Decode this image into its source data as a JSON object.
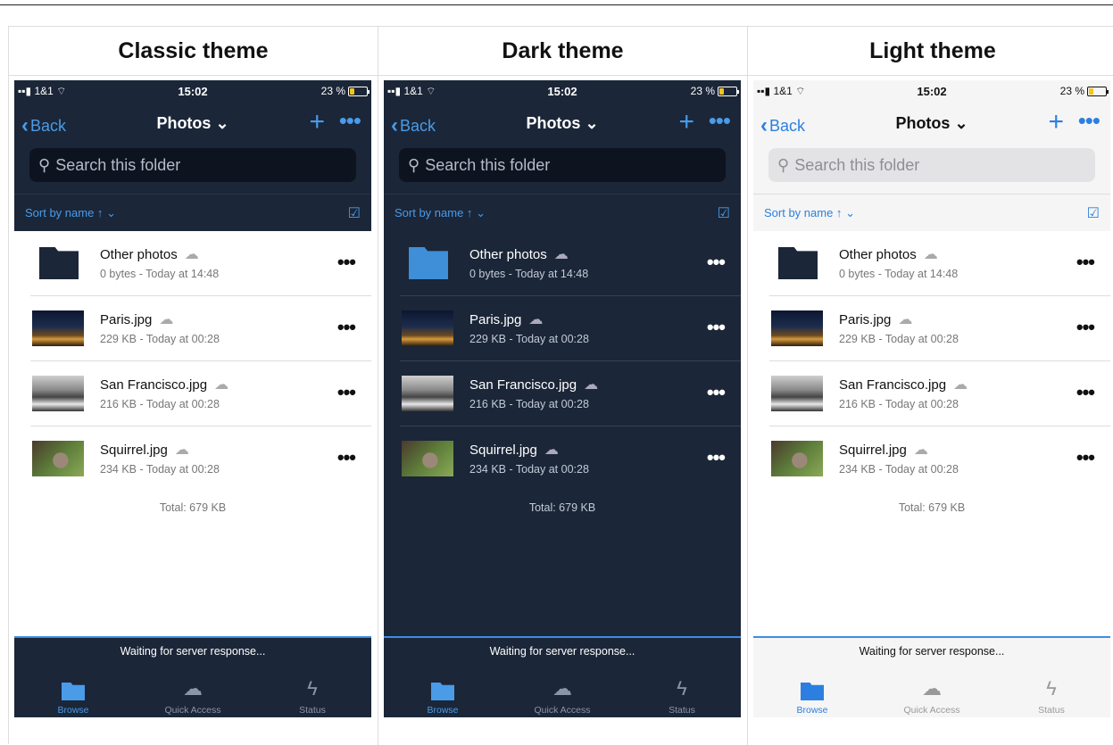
{
  "themes": [
    {
      "title": "Classic theme"
    },
    {
      "title": "Dark theme"
    },
    {
      "title": "Light theme"
    }
  ],
  "status": {
    "carrier": "1&1",
    "time": "15:02",
    "battery": "23 %"
  },
  "nav": {
    "back": "Back",
    "title": "Photos",
    "plus": "+",
    "more": "•••",
    "title_chevron": "⌄"
  },
  "search": {
    "placeholder": "Search this folder"
  },
  "sort": {
    "label": "Sort by name ↑",
    "chevron": "⌄"
  },
  "files": [
    {
      "name": "Other photos",
      "meta": "0 bytes - Today at 14:48",
      "kind": "folder"
    },
    {
      "name": "Paris.jpg",
      "meta": "229 KB - Today at 00:28",
      "kind": "paris"
    },
    {
      "name": "San Francisco.jpg",
      "meta": "216 KB - Today at 00:28",
      "kind": "sf"
    },
    {
      "name": "Squirrel.jpg",
      "meta": "234 KB - Today at 00:28",
      "kind": "squirrel"
    }
  ],
  "total": "Total: 679 KB",
  "waiting": "Waiting for server response...",
  "tabs": [
    {
      "label": "Browse",
      "icon": "folder-icon"
    },
    {
      "label": "Quick Access",
      "icon": "cloud-icon"
    },
    {
      "label": "Status",
      "icon": "lightning-icon"
    }
  ]
}
